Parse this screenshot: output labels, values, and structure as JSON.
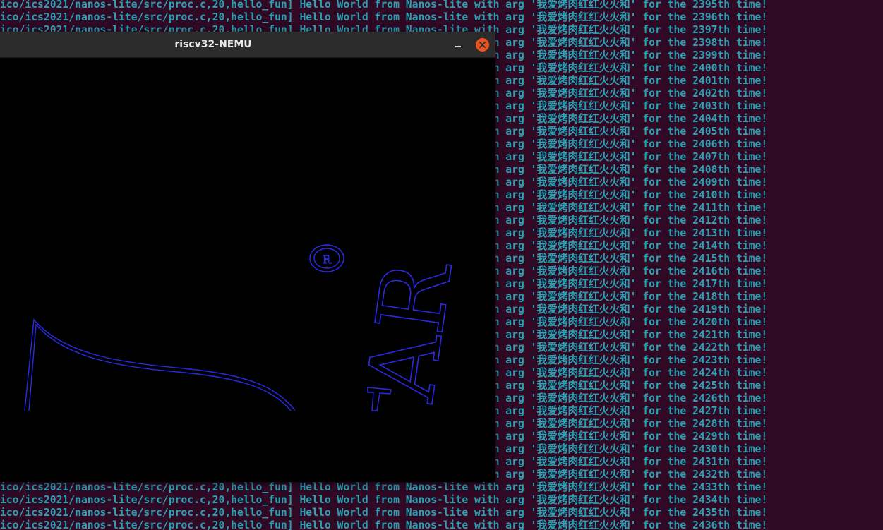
{
  "window": {
    "title": "riscv32-NEMU",
    "minimize_label": "–",
    "close_label": "×"
  },
  "terminal": {
    "lines": [
      "ico/ics2021/nanos-lite/src/proc.c,20,hello_fun] Hello World from Nanos-lite with arg '我爱烤肉红红火火和' for the 2395th time!",
      "ico/ics2021/nanos-lite/src/proc.c,20,hello_fun] Hello World from Nanos-lite with arg '我爱烤肉红红火火和' for the 2396th time!",
      "ico/ics2021/nanos-lite/src/proc.c,20,hello_fun] Hello World from Nanos-lite with arg '我爱烤肉红红火火和' for the 2397th time!",
      "ico/ics2021/nanos-lite/src/proc.c,20,hello_fun] Hello World from Nanos-lite with arg '我爱烤肉红红火火和' for the 2398th time!",
      "ico/ics2021/nanos-lite/src/proc.c,20,hello_fun] Hello World from Nanos-lite with arg '我爱烤肉红红火火和' for the 2399th time!",
      "ico/ics2021/nanos-lite/src/proc.c,20,hello_fun] Hello World from Nanos-lite with arg '我爱烤肉红红火火和' for the 2400th time!",
      "ico/ics2021/nanos-lite/src/proc.c,20,hello_fun] Hello World from Nanos-lite with arg '我爱烤肉红红火火和' for the 2401th time!",
      "ico/ics2021/nanos-lite/src/proc.c,20,hello_fun] Hello World from Nanos-lite with arg '我爱烤肉红红火火和' for the 2402th time!",
      "ico/ics2021/nanos-lite/src/proc.c,20,hello_fun] Hello World from Nanos-lite with arg '我爱烤肉红红火火和' for the 2403th time!",
      "ico/ics2021/nanos-lite/src/proc.c,20,hello_fun] Hello World from Nanos-lite with arg '我爱烤肉红红火火和' for the 2404th time!",
      "ico/ics2021/nanos-lite/src/proc.c,20,hello_fun] Hello World from Nanos-lite with arg '我爱烤肉红红火火和' for the 2405th time!",
      "ico/ics2021/nanos-lite/src/proc.c,20,hello_fun] Hello World from Nanos-lite with arg '我爱烤肉红红火火和' for the 2406th time!",
      "ico/ics2021/nanos-lite/src/proc.c,20,hello_fun] Hello World from Nanos-lite with arg '我爱烤肉红红火火和' for the 2407th time!",
      "ico/ics2021/nanos-lite/src/proc.c,20,hello_fun] Hello World from Nanos-lite with arg '我爱烤肉红红火火和' for the 2408th time!",
      "ico/ics2021/nanos-lite/src/proc.c,20,hello_fun] Hello World from Nanos-lite with arg '我爱烤肉红红火火和' for the 2409th time!",
      "ico/ics2021/nanos-lite/src/proc.c,20,hello_fun] Hello World from Nanos-lite with arg '我爱烤肉红红火火和' for the 2410th time!",
      "ico/ics2021/nanos-lite/src/proc.c,20,hello_fun] Hello World from Nanos-lite with arg '我爱烤肉红红火火和' for the 2411th time!",
      "ico/ics2021/nanos-lite/src/proc.c,20,hello_fun] Hello World from Nanos-lite with arg '我爱烤肉红红火火和' for the 2412th time!",
      "ico/ics2021/nanos-lite/src/proc.c,20,hello_fun] Hello World from Nanos-lite with arg '我爱烤肉红红火火和' for the 2413th time!",
      "ico/ics2021/nanos-lite/src/proc.c,20,hello_fun] Hello World from Nanos-lite with arg '我爱烤肉红红火火和' for the 2414th time!",
      "ico/ics2021/nanos-lite/src/proc.c,20,hello_fun] Hello World from Nanos-lite with arg '我爱烤肉红红火火和' for the 2415th time!",
      "ico/ics2021/nanos-lite/src/proc.c,20,hello_fun] Hello World from Nanos-lite with arg '我爱烤肉红红火火和' for the 2416th time!",
      "ico/ics2021/nanos-lite/src/proc.c,20,hello_fun] Hello World from Nanos-lite with arg '我爱烤肉红红火火和' for the 2417th time!",
      "ico/ics2021/nanos-lite/src/proc.c,20,hello_fun] Hello World from Nanos-lite with arg '我爱烤肉红红火火和' for the 2418th time!",
      "ico/ics2021/nanos-lite/src/proc.c,20,hello_fun] Hello World from Nanos-lite with arg '我爱烤肉红红火火和' for the 2419th time!",
      "ico/ics2021/nanos-lite/src/proc.c,20,hello_fun] Hello World from Nanos-lite with arg '我爱烤肉红红火火和' for the 2420th time!",
      "ico/ics2021/nanos-lite/src/proc.c,20,hello_fun] Hello World from Nanos-lite with arg '我爱烤肉红红火火和' for the 2421th time!",
      "ico/ics2021/nanos-lite/src/proc.c,20,hello_fun] Hello World from Nanos-lite with arg '我爱烤肉红红火火和' for the 2422th time!",
      "ico/ics2021/nanos-lite/src/proc.c,20,hello_fun] Hello World from Nanos-lite with arg '我爱烤肉红红火火和' for the 2423th time!",
      "ico/ics2021/nanos-lite/src/proc.c,20,hello_fun] Hello World from Nanos-lite with arg '我爱烤肉红红火火和' for the 2424th time!",
      "ico/ics2021/nanos-lite/src/proc.c,20,hello_fun] Hello World from Nanos-lite with arg '我爱烤肉红红火火和' for the 2425th time!",
      "ico/ics2021/nanos-lite/src/proc.c,20,hello_fun] Hello World from Nanos-lite with arg '我爱烤肉红红火火和' for the 2426th time!",
      "ico/ics2021/nanos-lite/src/proc.c,20,hello_fun] Hello World from Nanos-lite with arg '我爱烤肉红红火火和' for the 2427th time!",
      "ico/ics2021/nanos-lite/src/proc.c,20,hello_fun] Hello World from Nanos-lite with arg '我爱烤肉红红火火和' for the 2428th time!",
      "ico/ics2021/nanos-lite/src/proc.c,20,hello_fun] Hello World from Nanos-lite with arg '我爱烤肉红红火火和' for the 2429th time!",
      "ico/ics2021/nanos-lite/src/proc.c,20,hello_fun] Hello World from Nanos-lite with arg '我爱烤肉红红火火和' for the 2430th time!",
      "ico/ics2021/nanos-lite/src/proc.c,20,hello_fun] Hello World from Nanos-lite with arg '我爱烤肉红红火火和' for the 2431th time!",
      "ico/ics2021/nanos-lite/src/proc.c,20,hello_fun] Hello World from Nanos-lite with arg '我爱烤肉红红火火和' for the 2432th time!",
      "ico/ics2021/nanos-lite/src/proc.c,20,hello_fun] Hello World from Nanos-lite with arg '我爱烤肉红红火火和' for the 2433th time!",
      "ico/ics2021/nanos-lite/src/proc.c,20,hello_fun] Hello World from Nanos-lite with arg '我爱烤肉红红火火和' for the 2434th time!",
      "ico/ics2021/nanos-lite/src/proc.c,20,hello_fun] Hello World from Nanos-lite with arg '我爱烤肉红红火火和' for the 2435th time!",
      "ico/ics2021/nanos-lite/src/proc.c,20,hello_fun] Hello World from Nanos-lite with arg '我爱烤肉红红火火和' for the 2436th time!"
    ]
  },
  "canvas": {
    "registered_mark_text": "R",
    "glyph_text": "AR"
  },
  "colors": {
    "terminal_bg": "#300a24",
    "terminal_text": "#2aa1b3",
    "titlebar_bg": "#2c2c2c",
    "title_text": "#e8e8e8",
    "close_button": "#e95420",
    "canvas_bg": "#000000",
    "drawing_stroke": "#2a2ae6"
  },
  "icons": {
    "minimize": "minimize-icon",
    "close": "close-icon",
    "registered": "registered-mark-icon"
  }
}
